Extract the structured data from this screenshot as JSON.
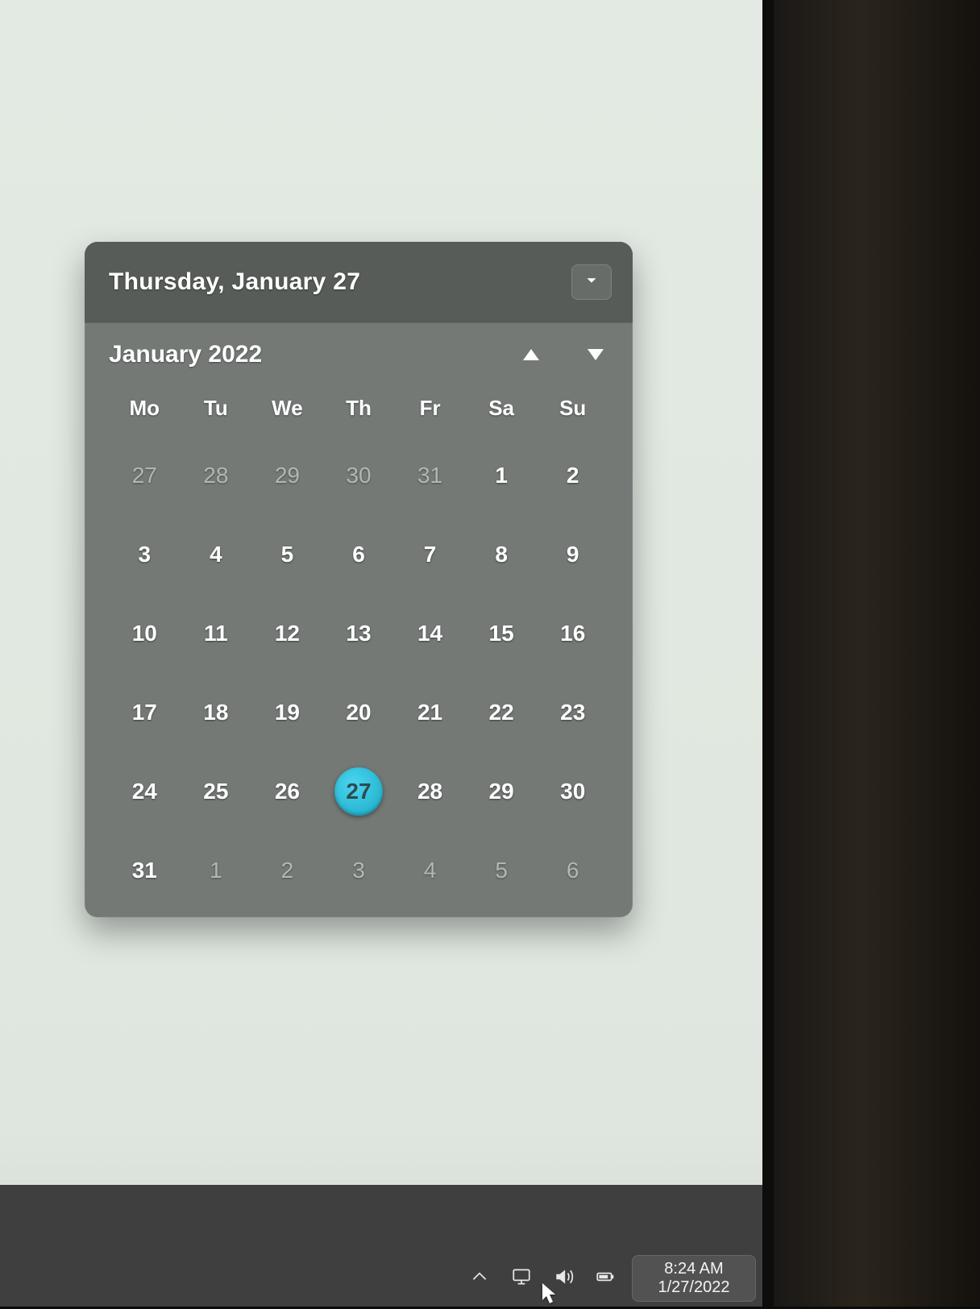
{
  "flyout": {
    "today_header": "Thursday, January 27",
    "month_label": "January 2022",
    "dow": [
      "Mo",
      "Tu",
      "We",
      "Th",
      "Fr",
      "Sa",
      "Su"
    ],
    "weeks": [
      [
        {
          "n": "27",
          "dim": true
        },
        {
          "n": "28",
          "dim": true
        },
        {
          "n": "29",
          "dim": true
        },
        {
          "n": "30",
          "dim": true
        },
        {
          "n": "31",
          "dim": true
        },
        {
          "n": "1"
        },
        {
          "n": "2"
        }
      ],
      [
        {
          "n": "3"
        },
        {
          "n": "4"
        },
        {
          "n": "5"
        },
        {
          "n": "6"
        },
        {
          "n": "7"
        },
        {
          "n": "8"
        },
        {
          "n": "9"
        }
      ],
      [
        {
          "n": "10"
        },
        {
          "n": "11"
        },
        {
          "n": "12"
        },
        {
          "n": "13"
        },
        {
          "n": "14"
        },
        {
          "n": "15"
        },
        {
          "n": "16"
        }
      ],
      [
        {
          "n": "17"
        },
        {
          "n": "18"
        },
        {
          "n": "19"
        },
        {
          "n": "20"
        },
        {
          "n": "21"
        },
        {
          "n": "22"
        },
        {
          "n": "23"
        }
      ],
      [
        {
          "n": "24"
        },
        {
          "n": "25"
        },
        {
          "n": "26"
        },
        {
          "n": "27",
          "today": true
        },
        {
          "n": "28"
        },
        {
          "n": "29"
        },
        {
          "n": "30"
        }
      ],
      [
        {
          "n": "31"
        },
        {
          "n": "1",
          "dim": true
        },
        {
          "n": "2",
          "dim": true
        },
        {
          "n": "3",
          "dim": true
        },
        {
          "n": "4",
          "dim": true
        },
        {
          "n": "5",
          "dim": true
        },
        {
          "n": "6",
          "dim": true
        }
      ]
    ]
  },
  "taskbar": {
    "time": "8:24 AM",
    "date": "1/27/2022"
  }
}
